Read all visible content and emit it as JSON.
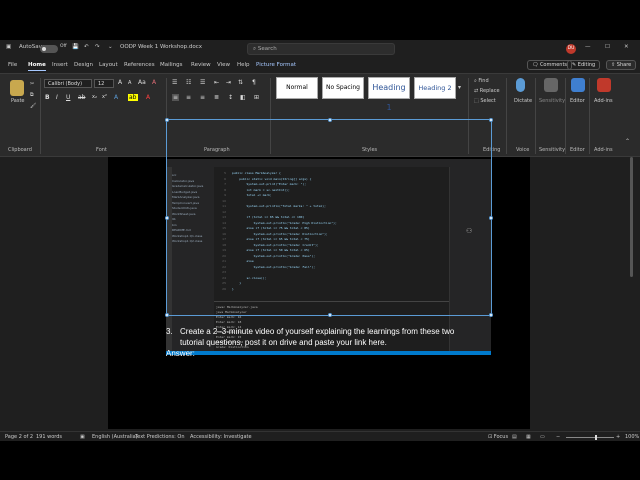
{
  "titlebar": {
    "autosave": "AutoSave",
    "autosave_state": "Off",
    "doc_name": "OODP Week 1 Workshop.docx",
    "search_placeholder": "Search",
    "avatar_initials": "DU"
  },
  "menu": {
    "items": [
      "File",
      "Home",
      "Insert",
      "Design",
      "Layout",
      "References",
      "Mailings",
      "Review",
      "View",
      "Help",
      "Picture Format"
    ],
    "comments": "Comments",
    "editing": "Editing",
    "share": "Share"
  },
  "ribbon": {
    "clipboard": {
      "paste": "Paste",
      "label": "Clipboard"
    },
    "font": {
      "name": "Calibri (Body)",
      "size": "12",
      "label": "Font"
    },
    "paragraph": {
      "label": "Paragraph"
    },
    "styles": {
      "items": [
        "Normal",
        "No Spacing",
        "Heading 1",
        "Heading 2"
      ],
      "label": "Styles"
    },
    "editing": {
      "find": "Find",
      "replace": "Replace",
      "select": "Select",
      "label": "Editing"
    },
    "voice": {
      "dictate": "Dictate",
      "label": "Voice"
    },
    "sensitivity": {
      "button": "Sensitivity",
      "label": "Sensitivity"
    },
    "editor": {
      "button": "Editor",
      "label": "Editor"
    },
    "addins": {
      "button": "Add-ins",
      "label": "Add-ins"
    }
  },
  "ide": {
    "files": [
      "src",
      "Calculator.java",
      "GradeCalculator.java",
      "LoanBudget.java",
      "MarkAnalyzer.java",
      "TempConvert.java",
      "StudentInfo.java",
      "WorkSheet.java",
      "lib",
      "bin",
      "README.md",
      "Workshop1 Q1.class",
      "Workshop1 Q2.class"
    ],
    "code": [
      "public class MarkAnalyzer {",
      "    public static void main(String[] args) {",
      "        System.out.print(\"Enter mark: \");",
      "        int mark = sc.nextInt();",
      "        total += mark;",
      "",
      "        System.out.println(\"Total marks: \" + total);",
      "",
      "        if (total >= 85 && total <= 100)",
      "            System.out.println(\"Grade: High Distinction\");",
      "        else if (total >= 75 && total < 85)",
      "            System.out.println(\"Grade: Distinction\");",
      "        else if (total >= 65 && total < 75)",
      "            System.out.println(\"Grade: Credit\");",
      "        else if (total >= 50 && total < 65)",
      "            System.out.println(\"Grade: Pass\");",
      "        else",
      "            System.out.println(\"Grade: Fail\");",
      "",
      "        sc.close();",
      "    }",
      "}"
    ],
    "terminal": [
      "javac MarkAnalyzer.java",
      "java MarkAnalyzer",
      "Enter mark: 16",
      "Enter mark: 18",
      "Enter mark: 14",
      "Enter mark: 19",
      "Enter mark: 15",
      "Total marks: 82",
      "Grade: Distinction"
    ]
  },
  "document": {
    "number": "3.",
    "question": "Create a 2–3-minute video of yourself explaining the learnings from these two tutorial questions, post it on drive and paste your link here.",
    "answer": "Answer:"
  },
  "status": {
    "page": "Page 2 of 2",
    "words": "191 words",
    "language": "English (Australia)",
    "predictions": "Text Predictions: On",
    "accessibility": "Accessibility: Investigate",
    "focus": "Focus",
    "zoom": "100%"
  }
}
